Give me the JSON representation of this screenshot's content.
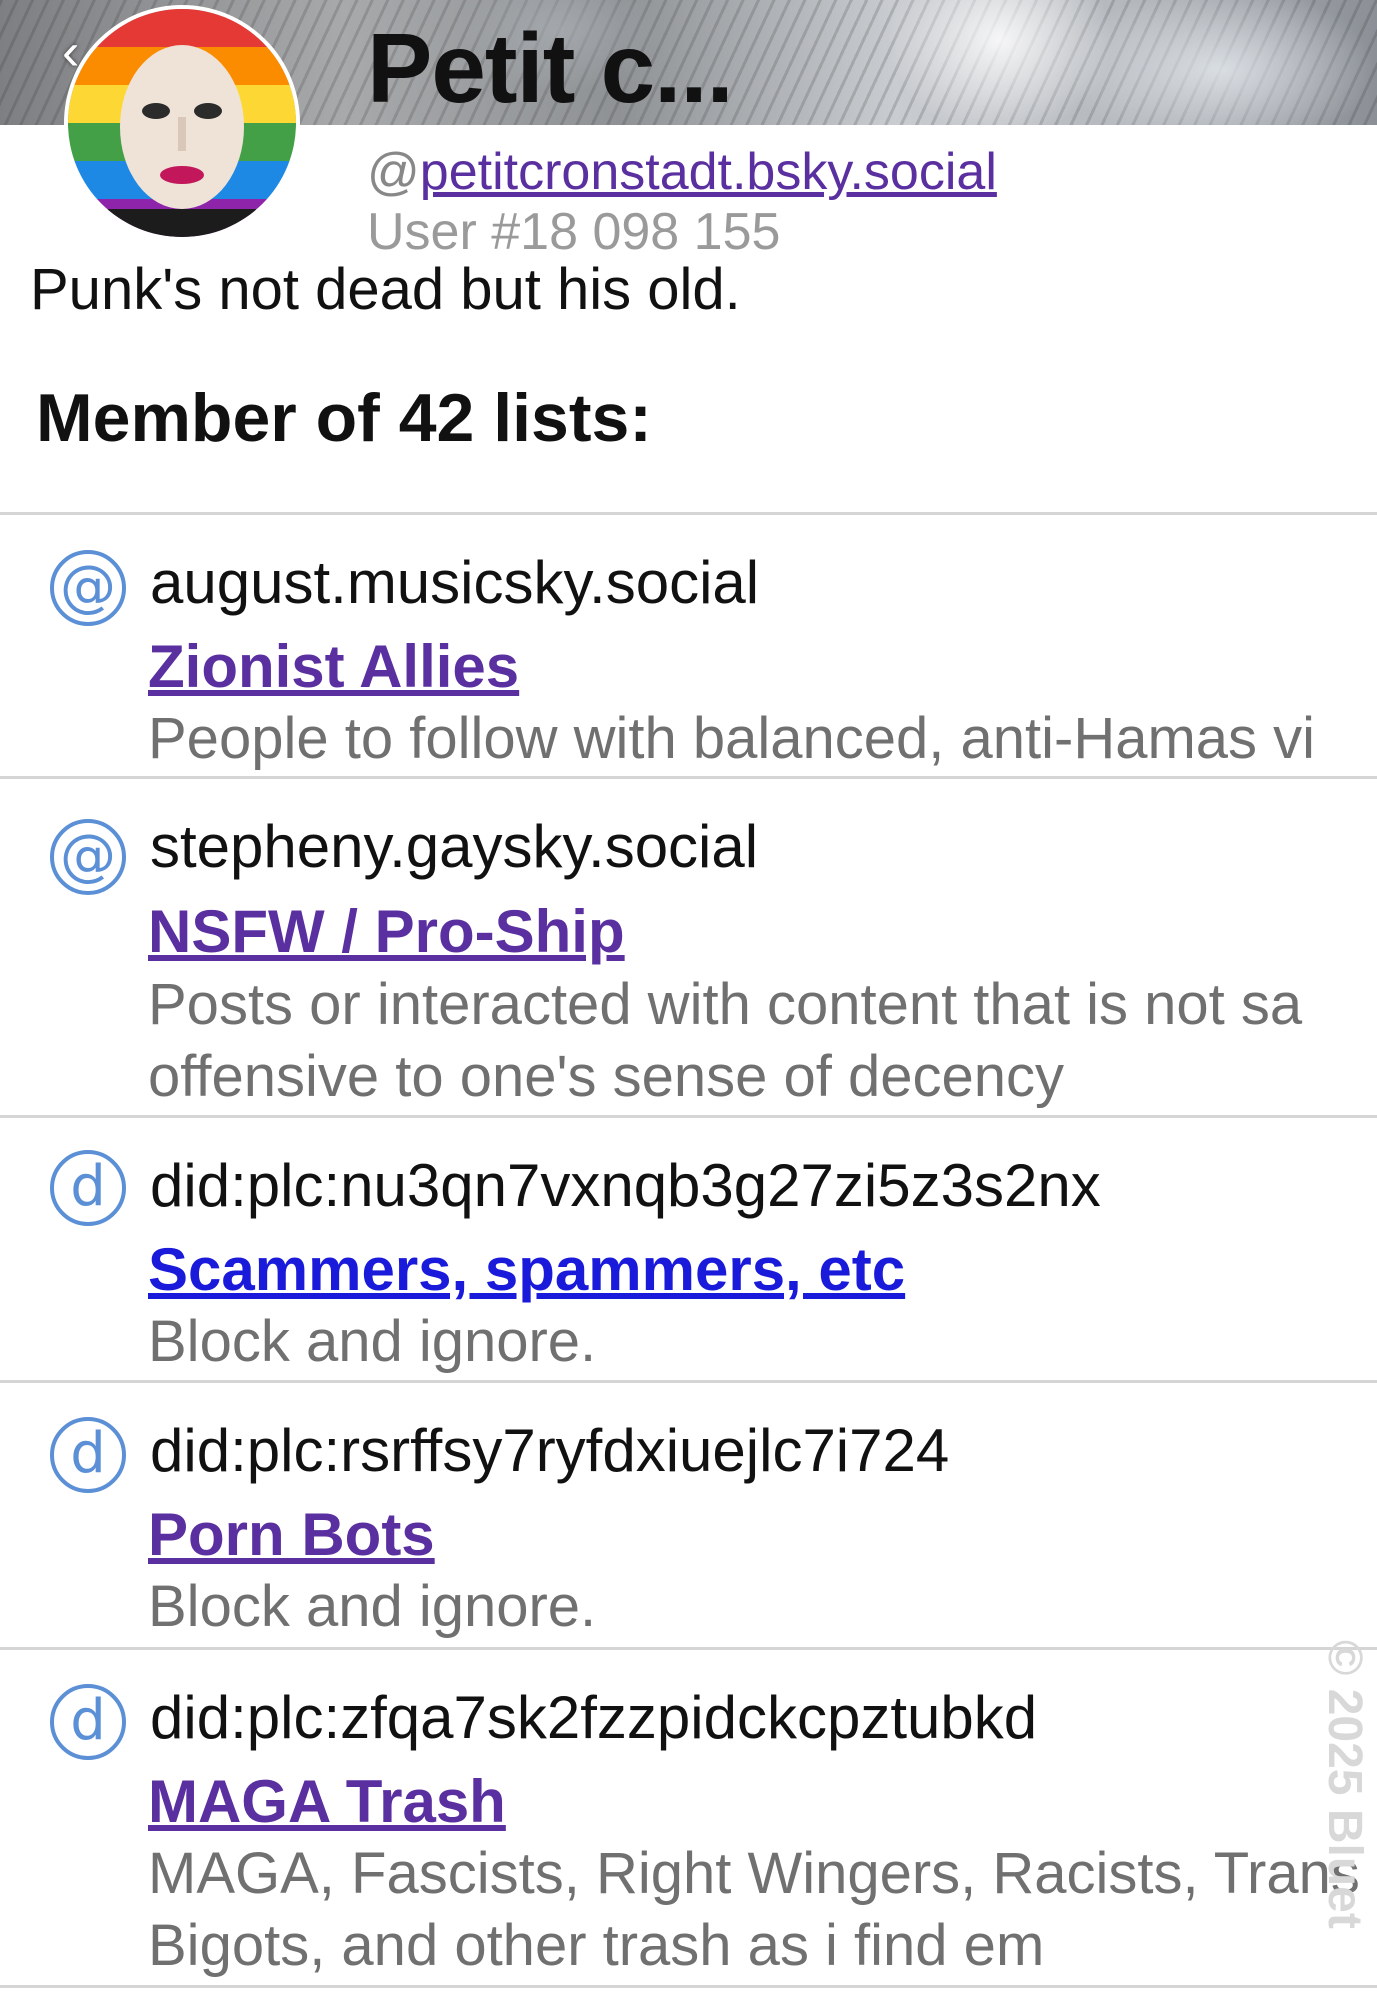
{
  "header": {
    "back_glyph": "‹",
    "display_name": "Petit c...",
    "handle_prefix": "@",
    "handle": "petitcronstadt.bsky.social",
    "user_number": "User #18 098 155",
    "bio": "Punk's not dead but his old."
  },
  "section": {
    "title": "Member of 42 lists:"
  },
  "colors": {
    "visited_link": "#5a2fa0",
    "unvisited_link": "#1a1adb",
    "icon_blue": "#5b8fd6",
    "description_gray": "#707070"
  },
  "lists": [
    {
      "icon": "@",
      "icon_name": "at-icon",
      "owner": "august.musicsky.social",
      "name": "Zionist Allies",
      "description": "People to follow with balanced, anti-Hamas vi"
    },
    {
      "icon": "@",
      "icon_name": "at-icon",
      "owner": "stepheny.gaysky.social",
      "name": "NSFW / Pro-Ship",
      "description": "Posts or interacted with content that is not sa\noffensive to one's sense of decency"
    },
    {
      "icon": "d",
      "icon_name": "did-icon",
      "owner": "did:plc:nu3qn7vxnqb3g27zi5z3s2nx",
      "name": "Scammers, spammers, etc",
      "description": "Block and ignore."
    },
    {
      "icon": "d",
      "icon_name": "did-icon",
      "owner": "did:plc:rsrffsy7ryfdxiuejlc7i724",
      "name": "Porn Bots",
      "description": "Block and ignore."
    },
    {
      "icon": "d",
      "icon_name": "did-icon",
      "owner": "did:plc:zfqa7sk2fzzpidckcpztubkd",
      "name": "MAGA Trash",
      "description": "MAGA, Fascists, Right Wingers, Racists, Trans\nBigots, and other trash as i find em"
    }
  ],
  "watermark": "© 2025 Bluet"
}
